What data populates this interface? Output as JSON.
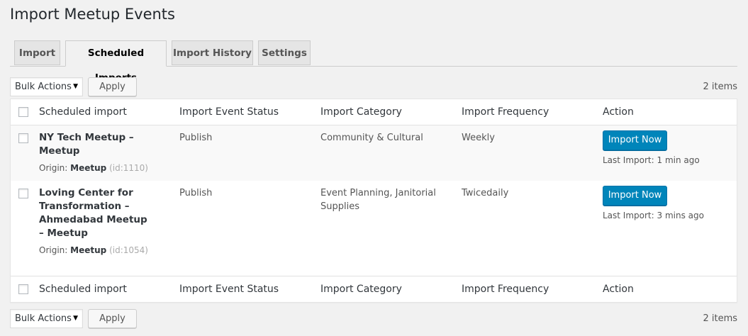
{
  "page": {
    "title": "Import Meetup Events"
  },
  "tabs": [
    {
      "label": "Import"
    },
    {
      "label": "Scheduled Imports"
    },
    {
      "label": "Import History"
    },
    {
      "label": "Settings"
    }
  ],
  "active_tab": "Scheduled Imports",
  "tablenav": {
    "bulk_actions": "Bulk Actions",
    "apply": "Apply",
    "items_count": "2 items"
  },
  "columns": [
    "Scheduled import",
    "Import Event Status",
    "Import Category",
    "Import Frequency",
    "Action"
  ],
  "rows": [
    {
      "title": "NY Tech Meetup – Meetup",
      "origin_label": "Origin:",
      "origin": "Meetup",
      "id": "(id:1110)",
      "status": "Publish",
      "category": "Community & Cultural",
      "frequency": "Weekly",
      "action_label": "Import Now",
      "last_import": "Last Import: 1 min ago"
    },
    {
      "title": "Loving Center for Transformation – Ahmedabad Meetup – Meetup",
      "origin_label": "Origin:",
      "origin": "Meetup",
      "id": "(id:1054)",
      "status": "Publish",
      "category": "Event Planning, Janitorial Supplies",
      "frequency": "Twicedaily",
      "action_label": "Import Now",
      "last_import": "Last Import: 3 mins ago"
    }
  ]
}
